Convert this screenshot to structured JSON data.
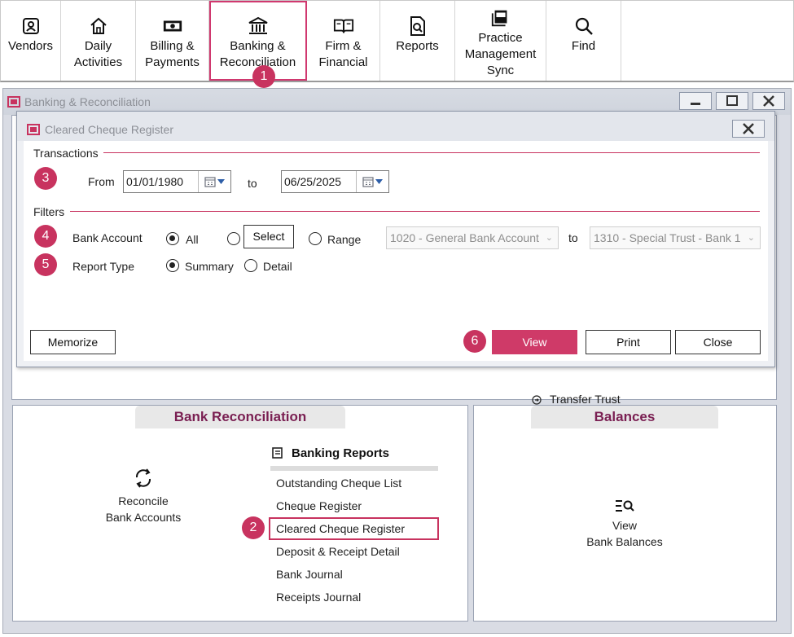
{
  "toolbar": {
    "items": [
      {
        "label": "Vendors",
        "icon": "vendor-contact-icon"
      },
      {
        "label": "Daily\nActivities",
        "icon": "home-icon"
      },
      {
        "label": "Billing &\nPayments",
        "icon": "money-icon"
      },
      {
        "label": "Banking &\nReconciliation",
        "icon": "bank-icon"
      },
      {
        "label": "Firm &\nFinancial",
        "icon": "book-icon"
      },
      {
        "label": "Reports",
        "icon": "report-search-icon"
      },
      {
        "label": "Practice\nManagement\nSync",
        "icon": "sync-book-icon"
      },
      {
        "label": "Find",
        "icon": "magnifier-icon"
      }
    ]
  },
  "badges": [
    "1",
    "2",
    "3",
    "4",
    "5",
    "6"
  ],
  "bg_window": {
    "title": "Banking & Reconciliation",
    "transfer_trust": "Transfer Trust",
    "bank_reconciliation": {
      "tab": "Bank Reconciliation",
      "reconcile": "Reconcile\nBank Accounts",
      "reports_heading": "Banking Reports",
      "reports": [
        "Outstanding Cheque List",
        "Cheque Register",
        "Cleared Cheque Register",
        "Deposit & Receipt Detail",
        "Bank Journal",
        "Receipts Journal"
      ]
    },
    "balances": {
      "tab": "Balances",
      "view": "View\nBank Balances"
    }
  },
  "dialog": {
    "title": "Cleared Cheque Register",
    "transactions_label": "Transactions",
    "from_label": "From",
    "from_value": "01/01/1980",
    "to_label": "to",
    "to_value": "06/25/2025",
    "filters_label": "Filters",
    "bank_account_label": "Bank Account",
    "opt_all": "All",
    "opt_select": "Select",
    "opt_range": "Range",
    "range_from": "1020 - General Bank Account",
    "range_to_label": "to",
    "range_to": "1310 - Special Trust - Bank 1",
    "report_type_label": "Report Type",
    "opt_summary": "Summary",
    "opt_detail": "Detail",
    "memorize": "Memorize",
    "view": "View",
    "print": "Print",
    "close": "Close"
  },
  "colors": {
    "accent": "#cf3a68",
    "heading": "#7a1f52"
  }
}
